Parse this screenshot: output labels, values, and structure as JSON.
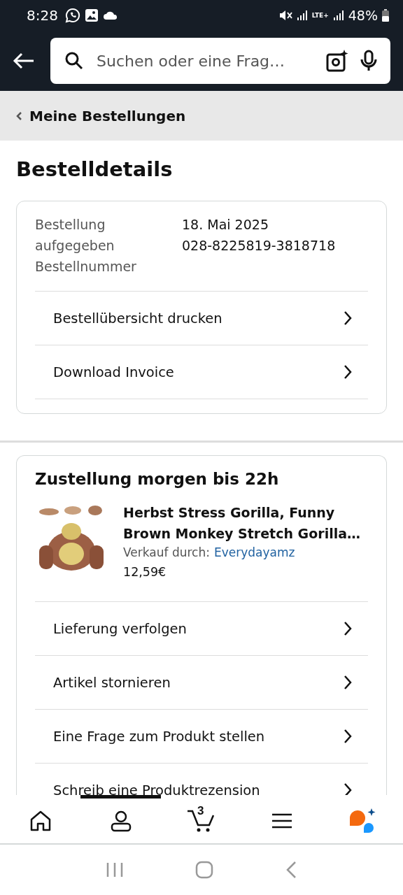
{
  "status_bar": {
    "time": "8:28",
    "network": "LTE+",
    "battery": "48%"
  },
  "search": {
    "placeholder": "Suchen oder eine Frag…"
  },
  "breadcrumb": {
    "label": "Meine Bestellungen"
  },
  "title": "Bestelldetails",
  "order": {
    "labels": [
      "Bestellung aufgegeben",
      "Bestellnummer"
    ],
    "values": [
      "18. Mai 2025",
      "028-8225819-3818718"
    ],
    "links": [
      "Bestellübersicht drucken",
      "Download Invoice"
    ]
  },
  "shipment": {
    "heading": "Zustellung morgen bis 22h",
    "product": {
      "kind": "picture",
      "name": "Herbst Stress Gorilla, Funny Brown Monkey Stretch Gorilla…",
      "seller_label": "Verkauf durch:",
      "seller": "Everydayamz",
      "price": "12,59€"
    },
    "actions": [
      "Lieferung verfolgen",
      "Artikel stornieren",
      "Eine Frage zum Produkt stellen",
      "Schreib eine Produktrezension"
    ]
  },
  "bottom_nav": [
    {
      "kind": "home",
      "selected": false
    },
    {
      "kind": "account",
      "selected": true
    },
    {
      "kind": "cart",
      "badge": "3",
      "selected": false
    },
    {
      "kind": "menu",
      "selected": false
    },
    {
      "kind": "assistant",
      "selected": false
    }
  ]
}
